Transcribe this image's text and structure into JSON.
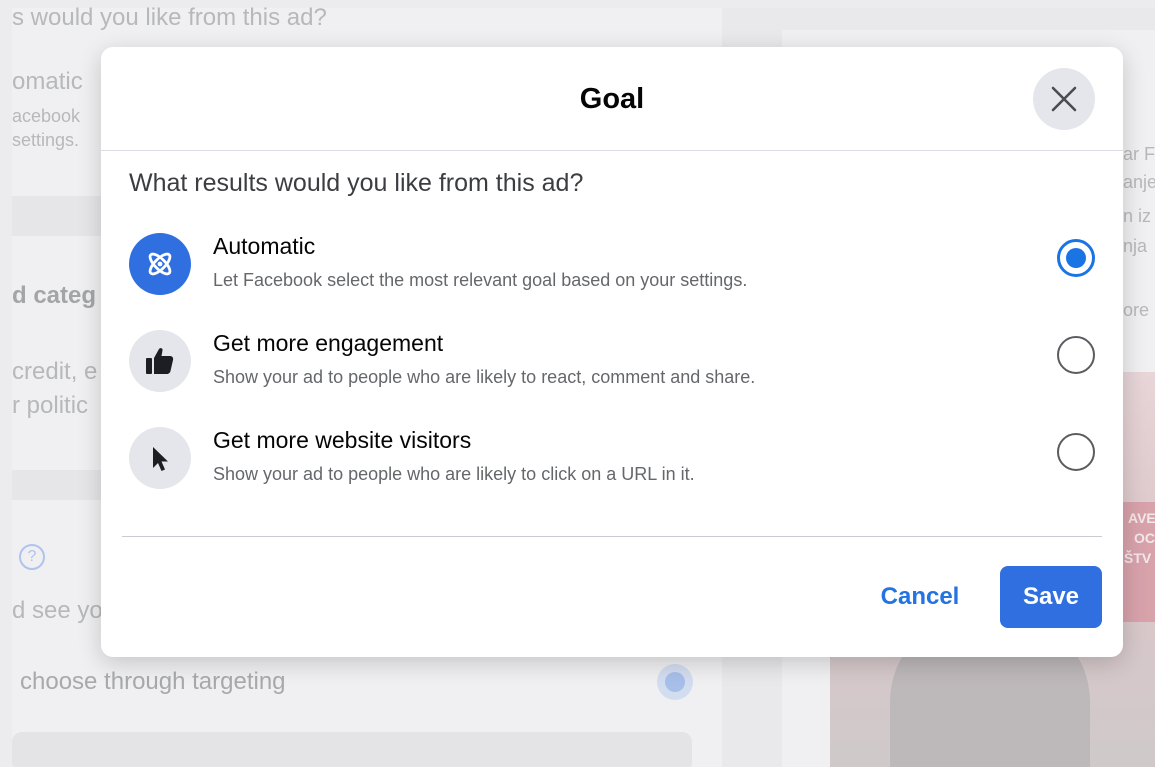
{
  "background": {
    "left_texts": [
      "s would you like from this ad?",
      "omatic",
      "acebook",
      "settings.",
      "d categ",
      "credit, e",
      "r politic",
      "d see yo",
      "choose through targeting"
    ],
    "help_icon": "?",
    "right_texts": [
      "ar F",
      "anje",
      "n iz",
      "nja",
      "ore",
      "AVE",
      "OC",
      "ŠTV"
    ]
  },
  "modal": {
    "title": "Goal",
    "close_icon": "close-x-icon",
    "question": "What results would you like from this ad?",
    "options": [
      {
        "title": "Automatic",
        "description": "Let Facebook select the most relevant goal based on your settings.",
        "icon": "atom-icon",
        "selected": true
      },
      {
        "title": "Get more engagement",
        "description": "Show your ad to people who are likely to react, comment and share.",
        "icon": "thumbs-up-icon",
        "selected": false
      },
      {
        "title": "Get more website visitors",
        "description": "Show your ad to people who are likely to click on a URL in it.",
        "icon": "cursor-pointer-icon",
        "selected": false
      }
    ],
    "cancel_label": "Cancel",
    "save_label": "Save"
  },
  "colors": {
    "accent": "#1b74e4",
    "save_button": "#2f6fe0",
    "icon_bg": "#e4e6eb",
    "secondary_text": "#65676b"
  }
}
